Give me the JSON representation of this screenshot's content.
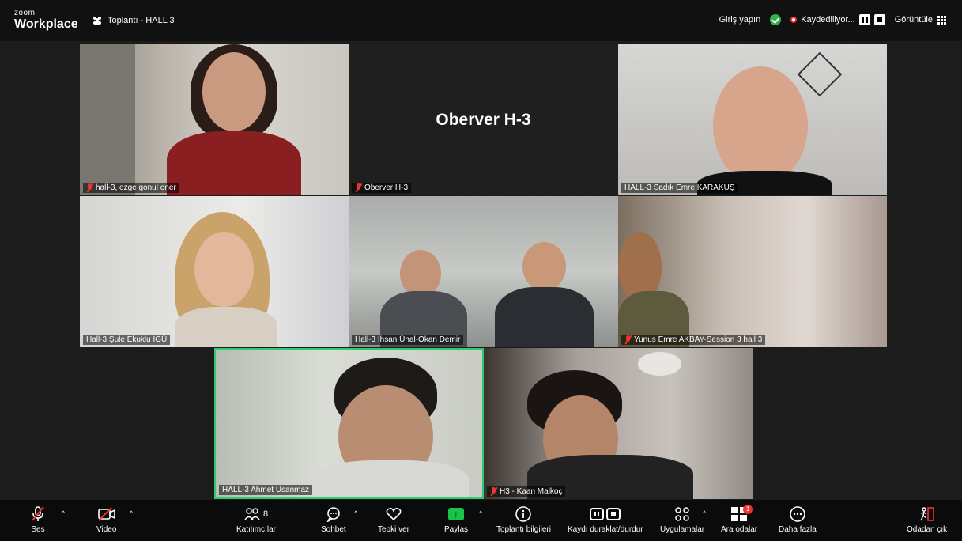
{
  "app": {
    "logo_small": "zoom",
    "logo_big": "Workplace"
  },
  "meeting": {
    "title": "Toplantı - HALL 3"
  },
  "topbar": {
    "sign_in": "Giriş yapın",
    "recording_status": "Kaydediliyor...",
    "view_label": "Görüntüle"
  },
  "tiles": [
    {
      "label": "hall-3, ozge gonul oner",
      "muted": true
    },
    {
      "label": "Oberver H-3",
      "muted": true,
      "center_text": "Oberver H-3"
    },
    {
      "label": "HALL-3 Sadık Emre KARAKUŞ",
      "muted": false
    },
    {
      "label": "Hall-3 Şule Ekuklu İGÜ",
      "muted": false
    },
    {
      "label": "Hall-3 İhsan Ünal-Okan Demir",
      "muted": false
    },
    {
      "label": "Yunus Emre AKBAY-Session 3 hall 3",
      "muted": true
    },
    {
      "label": "HALL-3 Ahmet Usanmaz",
      "muted": false,
      "active_speaker": true
    },
    {
      "label": "H3 - Kaan Malkoç",
      "muted": true
    }
  ],
  "toolbar": {
    "audio": "Ses",
    "video": "Video",
    "participants": "Katılımcılar",
    "participants_count": "8",
    "chat": "Sohbet",
    "react": "Tepki ver",
    "share": "Paylaş",
    "meeting_info": "Toplantı bilgileri",
    "record_pause_stop": "Kaydı duraklat/durdur",
    "apps": "Uygulamalar",
    "breakout": "Ara odalar",
    "breakout_badge": "1",
    "more": "Daha fazla",
    "leave": "Odadan çık"
  },
  "colors": {
    "active_speaker_border": "#2ecc71",
    "share_green": "#19c34a",
    "recording_red": "#e33333"
  }
}
